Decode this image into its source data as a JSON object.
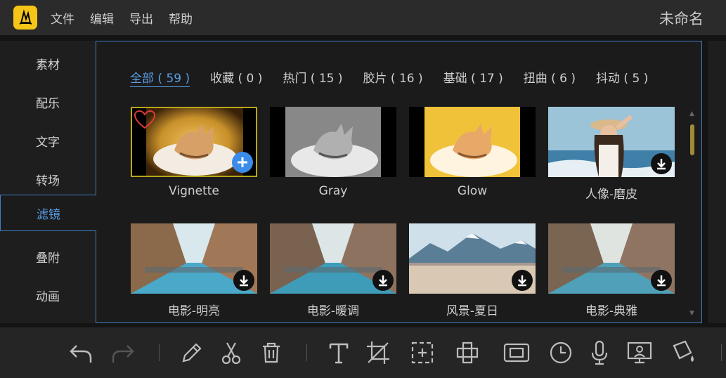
{
  "app": {
    "title": "未命名",
    "menu": [
      "文件",
      "编辑",
      "导出",
      "帮助"
    ]
  },
  "sidebar": {
    "tabs": [
      "素材",
      "配乐",
      "文字",
      "转场",
      "滤镜",
      "叠附",
      "动画"
    ],
    "active_index": 4
  },
  "filters": {
    "tabs": [
      "全部 ( 59 )",
      "收藏 ( 0 )",
      "热门 ( 15 )",
      "胶片 ( 16 )",
      "基础 ( 17 )",
      "扭曲 ( 6 )",
      "抖动 ( 5 )"
    ],
    "active_index": 0
  },
  "grid": {
    "items": [
      {
        "label": "Vignette",
        "thumb": "cat-vignette",
        "selected": true,
        "badge": "add-icon"
      },
      {
        "label": "Gray",
        "thumb": "cat-gray",
        "selected": false,
        "badge": ""
      },
      {
        "label": "Glow",
        "thumb": "cat-glow",
        "selected": false,
        "badge": ""
      },
      {
        "label": "人像-磨皮",
        "thumb": "portrait-beach",
        "selected": false,
        "badge": "download-icon"
      },
      {
        "label": "电影-明亮",
        "thumb": "street",
        "selected": false,
        "badge": "download-icon"
      },
      {
        "label": "电影-暖调",
        "thumb": "street",
        "selected": false,
        "badge": "download-icon"
      },
      {
        "label": "风景-夏日",
        "thumb": "mountain",
        "selected": false,
        "badge": "download-icon"
      },
      {
        "label": "电影-典雅",
        "thumb": "street",
        "selected": false,
        "badge": "download-icon"
      }
    ]
  },
  "toolbar": {
    "tools": [
      "undo-icon",
      "redo-icon",
      "pen-icon",
      "scissors-icon",
      "trash-icon",
      "text-icon",
      "crop-icon",
      "zoom-icon",
      "mosaic-icon",
      "frame-icon",
      "clock-icon",
      "microphone-icon",
      "screen-icon",
      "paint-bucket-icon"
    ]
  },
  "colors": {
    "accent": "#3d7fc4",
    "accent_text": "#5a9fe8",
    "selected_border": "#b8a61a",
    "logo": "#f5c518",
    "add_badge": "#3b8be8"
  }
}
